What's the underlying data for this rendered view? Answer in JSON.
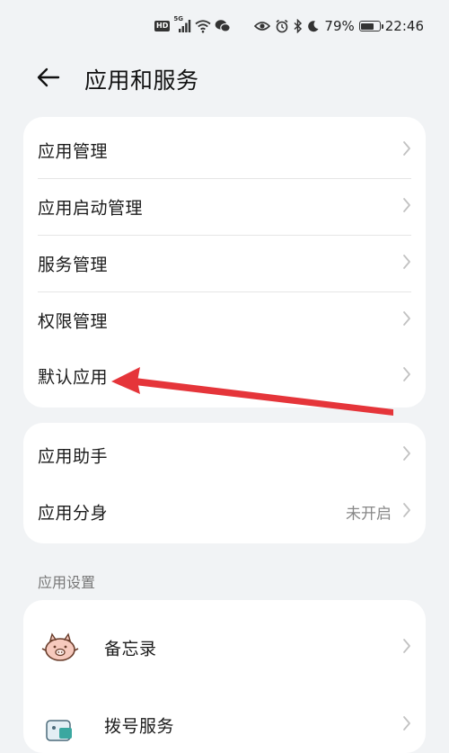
{
  "status_bar": {
    "hd": "HD",
    "network": "5G",
    "battery_text": "79%",
    "battery_level": 0.79,
    "time": "22:46"
  },
  "header": {
    "title": "应用和服务"
  },
  "group1": {
    "items": [
      {
        "label": "应用管理"
      },
      {
        "label": "应用启动管理"
      },
      {
        "label": "服务管理"
      },
      {
        "label": "权限管理"
      },
      {
        "label": "默认应用"
      }
    ]
  },
  "group2": {
    "items": [
      {
        "label": "应用助手"
      },
      {
        "label": "应用分身",
        "value": "未开启"
      }
    ]
  },
  "section_heading": "应用设置",
  "group3": {
    "items": [
      {
        "label": "备忘录",
        "icon": "memo-pig-icon"
      },
      {
        "label": "拨号服务",
        "icon": "dialer-icon"
      }
    ]
  },
  "colors": {
    "background": "#f1f3f5",
    "card": "#ffffff",
    "annotation_arrow": "#e5353a",
    "secondary_text": "#888888"
  }
}
